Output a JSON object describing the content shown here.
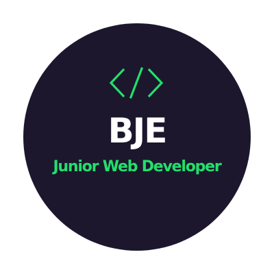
{
  "logo": {
    "icon": "code-brackets-icon",
    "monogram": "BJE",
    "tagline": "Junior Web Developer"
  },
  "colors": {
    "background": "#ffffff",
    "circle": "#1c172d",
    "accent": "#22e06b",
    "monogram": "#ffffff"
  }
}
